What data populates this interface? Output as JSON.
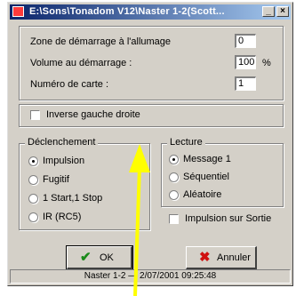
{
  "window": {
    "title": "E:\\Sons\\Tonadom V12\\Naster 1-2(Scott...",
    "minimize": "_",
    "close": "×"
  },
  "fields": {
    "zone": {
      "label": "Zone de démarrage à l'allumage",
      "value": "0"
    },
    "volume": {
      "label": "Volume au démarrage :",
      "value": "100",
      "unit": "%"
    },
    "carte": {
      "label": "Numéro de carte :",
      "value": "1"
    }
  },
  "inverse": {
    "label": "Inverse gauche droite",
    "checked": false
  },
  "declenchement": {
    "title": "Déclenchement",
    "options": [
      {
        "label": "Impulsion",
        "selected": true
      },
      {
        "label": "Fugitif",
        "selected": false
      },
      {
        "label": "1 Start,1 Stop",
        "selected": false
      },
      {
        "label": "IR (RC5)",
        "selected": false
      }
    ]
  },
  "lecture": {
    "title": "Lecture",
    "options": [
      {
        "label": "Message 1",
        "selected": true
      },
      {
        "label": "Séquentiel",
        "selected": false
      },
      {
        "label": "Aléatoire",
        "selected": false
      }
    ]
  },
  "impulsion_sortie": {
    "label": "Impulsion sur Sortie",
    "checked": false
  },
  "buttons": {
    "ok": {
      "label": "OK",
      "icon": "checkmark-icon",
      "color": "#1a8a1a"
    },
    "cancel": {
      "label": "Annuler",
      "icon": "x-icon",
      "color": "#d01010"
    }
  },
  "status": "Naster 1-2 — 2/07/2001 09:25:48",
  "overlay": {
    "arrow_color": "#ffff00"
  }
}
